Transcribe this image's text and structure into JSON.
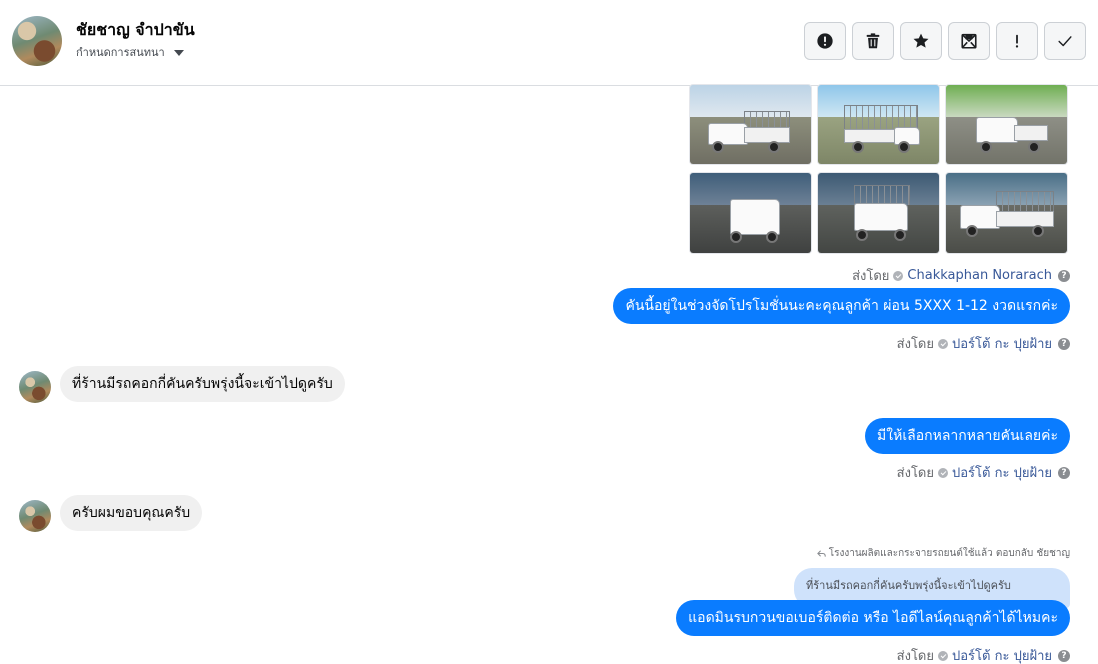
{
  "header": {
    "contact_name": "ชัยชาญ จำปาขัน",
    "subtitle": "กำหนดการสนทนา",
    "actions": [
      {
        "name": "report-button",
        "icon": "alert-circle-icon"
      },
      {
        "name": "delete-button",
        "icon": "trash-icon"
      },
      {
        "name": "star-button",
        "icon": "star-icon"
      },
      {
        "name": "mark-unread-button",
        "icon": "envelope-open-icon"
      },
      {
        "name": "important-button",
        "icon": "exclamation-icon"
      },
      {
        "name": "done-button",
        "icon": "check-icon"
      }
    ]
  },
  "photos": {
    "count": 6,
    "description_icon": "truck-photo"
  },
  "messages": [
    {
      "id": "m1",
      "direction": "sent_by",
      "sender_label": "ส่งโดย",
      "sender": "Chakkaphan Norarach"
    },
    {
      "id": "m2",
      "direction": "out",
      "text": "คันนี้อยู่ในช่วงจัดโปรโมชั่นนะคะคุณลูกค้า ผ่อน 5XXX  1-12 งวดแรกค่ะ",
      "sender_label": "ส่งโดย",
      "sender": "ปอร์โต้ กะ ปุยฝ้าย"
    },
    {
      "id": "m3",
      "direction": "in",
      "text": "ที่ร้านมีรถคอกกี่คันครับพรุ่งนี้จะเข้าไปดูครับ"
    },
    {
      "id": "m4",
      "direction": "out",
      "text": "มีให้เลือกหลากหลายคันเลยค่ะ",
      "sender_label": "ส่งโดย",
      "sender": "ปอร์โต้ กะ ปุยฝ้าย"
    },
    {
      "id": "m5",
      "direction": "in",
      "text": "ครับผมขอบคุณครับ"
    },
    {
      "id": "m6",
      "direction": "out",
      "reply_note": "โรงงานผลิตและกระจายรถยนต์ใช้แล้ว ตอบกลับ ชัยชาญ",
      "quoted_text": "ที่ร้านมีรถคอกกี่คันครับพรุ่งนี้จะเข้าไปดูครับ",
      "text": "แอดมินรบกวนขอเบอร์ติดต่อ หรือ ไอดีไลน์คุณลูกค้าได้ไหมคะ",
      "sender_label": "ส่งโดย",
      "sender": "ปอร์โต้ กะ ปุยฝ้าย"
    }
  ],
  "colors": {
    "bubble_out": "#0a7cff",
    "bubble_in": "#f0f0f0",
    "reply_quote": "#cfe2fb",
    "sender_name_link": "#385898"
  }
}
